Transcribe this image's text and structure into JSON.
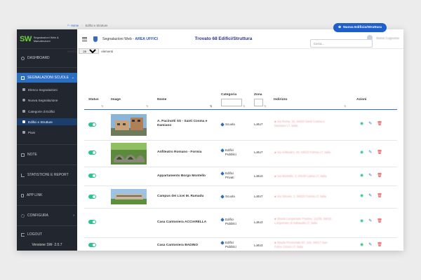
{
  "sidebar": {
    "logo_mark": "SW",
    "logo_text": "Segnalazioni Web & Manutenzioni",
    "items": {
      "dashboard": "DASHBOARD",
      "segnalazioni": "SEGNALAZIONI SCUOLE",
      "note": "NOTE",
      "statistiche": "STATISTICHE E REPORT",
      "applink": "APP LINK",
      "configura": "CONFIGURA",
      "logout": "LOGOUT"
    },
    "sub": {
      "elenco": "Elenco Segnalazioni",
      "nuova": "Nuova Segnalazione",
      "categorie": "Categorie di Edifici",
      "edifici": "Edifici e Strutture",
      "piani": "Piani"
    },
    "version": "Versione SW- 2.0.7"
  },
  "topbar": {
    "title_prefix": "Segnalazioni Web - ",
    "title_area": "AREA UFFICI",
    "user_name": "Nome Cognome"
  },
  "breadcrumb": {
    "home": "Home",
    "current": "Edifici e Strutture"
  },
  "new_button": "Nuova Edificio/Struttura",
  "heading": {
    "prefix": "Trovato ",
    "count": "68",
    "suffix": " Edifici/Struttura"
  },
  "search_placeholder": "Cerca...",
  "length": {
    "show": "Mostra",
    "value": "25",
    "elements": "elementi"
  },
  "columns": {
    "status": "Status",
    "image": "Image",
    "nome": "Nome",
    "categoria": "Categoria",
    "zona": "Zona",
    "indirizzo": "Indirizzo",
    "azioni": "Azioni"
  },
  "rows": [
    {
      "nome": "A. Pacinotti SS - Santi Cosma e Damiano",
      "categoria": "Scuola",
      "zona": "Lotto7",
      "indirizzo": "Via Roma, 18, 04020 Santi Cosma e Damiano LT, Italia"
    },
    {
      "nome": "Anfiteatro Romano - Formia",
      "categoria": "Edifici Pubblici",
      "zona": "Lotto7",
      "indirizzo": "Via Anfiteatro, 00, 04023 Formia LT, Italia"
    },
    {
      "nome": "Appartamento Borgo Montello",
      "categoria": "Edifici Privati",
      "zona": "Lotto3",
      "indirizzo": "Via Montello, 3, 04100 Latina LT, Italia"
    },
    {
      "nome": "Campus dei Licei M. Ramadu",
      "categoria": "Scuola",
      "zona": "Lotto7",
      "indirizzo": "Via Vitruvio, 2, 04023 Formia LT, Italia"
    },
    {
      "nome": "Casa Cantoniera ACCIARELLA",
      "categoria": "Edifici Pubblici",
      "zona": "Lotto3",
      "indirizzo": "Strada Lungomare Pontino, 11235, 04010 Lungomare di Sabaudia LT, Italia"
    },
    {
      "nome": "Casa Cantoniera BADINO",
      "categoria": "Edifici Pubblici",
      "zona": "Lotto3",
      "indirizzo": "Strada Provinciale 87, 102, 04017 San Felice Circeo LT, Italia"
    }
  ]
}
